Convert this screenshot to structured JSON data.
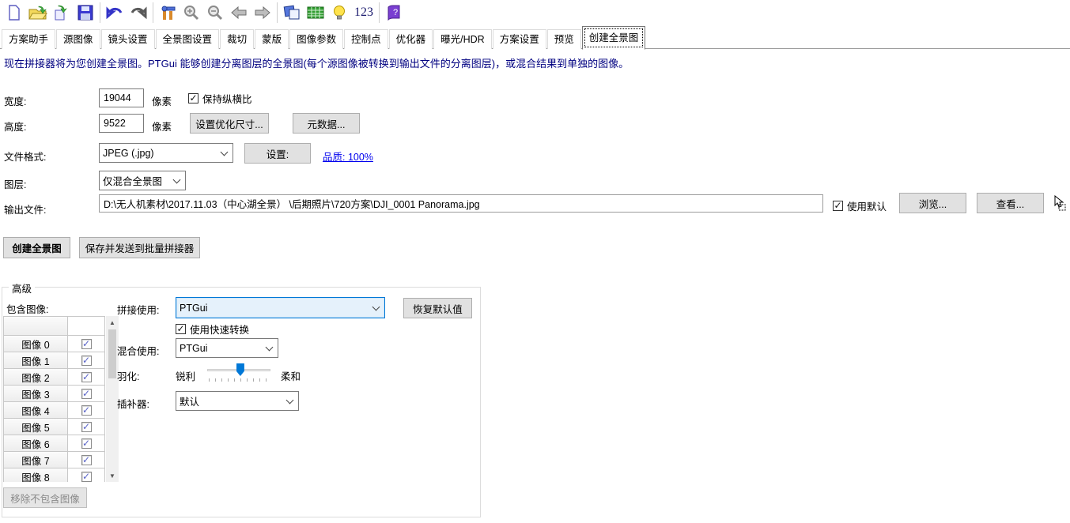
{
  "toolbar": {
    "icons": [
      "new-project-icon",
      "open-project-icon",
      "apply-template-icon",
      "save-project-icon",
      "undo-icon",
      "redo-icon",
      "tools-icon",
      "zoom-in-icon",
      "zoom-out-icon",
      "previous-icon",
      "next-icon",
      "panorama-editor-icon",
      "detail-viewer-icon",
      "hint-icon",
      "numbers-icon",
      "help-icon"
    ],
    "numbers_label": "123"
  },
  "tabs": {
    "items": [
      "方案助手",
      "源图像",
      "镜头设置",
      "全景图设置",
      "裁切",
      "蒙版",
      "图像参数",
      "控制点",
      "优化器",
      "曝光/HDR",
      "方案设置",
      "预览",
      "创建全景图"
    ],
    "selected": "创建全景图"
  },
  "description": "现在拼接器将为您创建全景图。PTGui 能够创建分离图层的全景图(每个源图像被转换到输出文件的分离图层)，或混合结果到单独的图像。",
  "form": {
    "width_label": "宽度:",
    "width_value": "19044",
    "width_unit": "像素",
    "keep_aspect_label": "保持纵横比",
    "keep_aspect_checked": true,
    "height_label": "高度:",
    "height_value": "9522",
    "height_unit": "像素",
    "optimum_size_button": "设置优化尺寸...",
    "metadata_button": "元数据...",
    "file_format_label": "文件格式:",
    "file_format_value": "JPEG (.jpg)",
    "format_settings_button": "设置:",
    "quality_link": "品质: 100%",
    "layers_label": "图层:",
    "layers_value": "仅混合全景图",
    "output_file_label": "输出文件:",
    "output_file_value": "D:\\无人机素材\\2017.11.03（中心湖全景） \\后期照片\\720方案\\DJI_0001 Panorama.jpg",
    "use_default_label": "使用默认",
    "use_default_checked": true,
    "browse_button": "浏览...",
    "view_button": "查看..."
  },
  "actions": {
    "create_button": "创建全景图",
    "send_batch_button": "保存并发送到批量拼接器"
  },
  "advanced": {
    "group_title": "高级",
    "include_images_label": "包含图像:",
    "image_rows": [
      "图像 0",
      "图像 1",
      "图像 2",
      "图像 3",
      "图像 4",
      "图像 5",
      "图像 6",
      "图像 7",
      "图像 8"
    ],
    "all_rows_checked": true,
    "stitch_using_label": "拼接使用:",
    "stitch_using_value": "PTGui",
    "restore_defaults_button": "恢复默认值",
    "fast_transform_label": "使用快速转换",
    "fast_transform_checked": true,
    "blend_using_label": "混合使用:",
    "blend_using_value": "PTGui",
    "feather_label": "羽化:",
    "feather_min_label": "锐利",
    "feather_max_label": "柔和",
    "feather_percent": 45,
    "interpolator_label": "插补器:",
    "interpolator_value": "默认",
    "remove_unincluded_button": "移除不包含图像"
  }
}
